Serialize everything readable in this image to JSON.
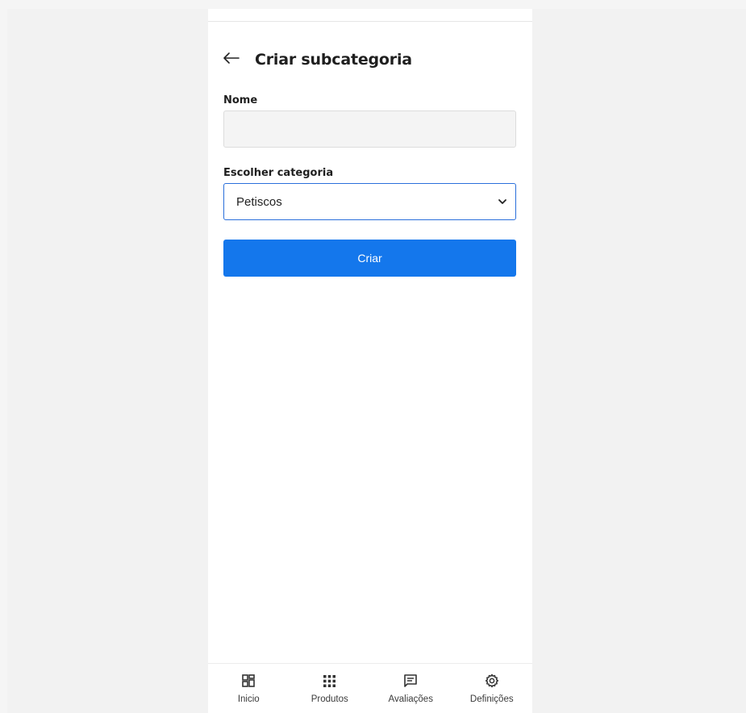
{
  "header": {
    "title": "Criar subcategoria",
    "back_icon": "arrow-left-icon"
  },
  "form": {
    "name_label": "Nome",
    "name_value": "",
    "name_placeholder": "",
    "category_label": "Escolher categoria",
    "category_selected": "Petiscos",
    "submit_label": "Criar"
  },
  "bottom_nav": {
    "items": [
      {
        "label": "Inicio",
        "icon": "dashboard-icon"
      },
      {
        "label": "Produtos",
        "icon": "grid-icon"
      },
      {
        "label": "Avaliações",
        "icon": "comment-icon"
      },
      {
        "label": "Definições",
        "icon": "gear-icon"
      }
    ]
  },
  "colors": {
    "accent": "#1477ec",
    "select_border": "#2a6fdb",
    "input_bg": "#f4f4f4"
  }
}
